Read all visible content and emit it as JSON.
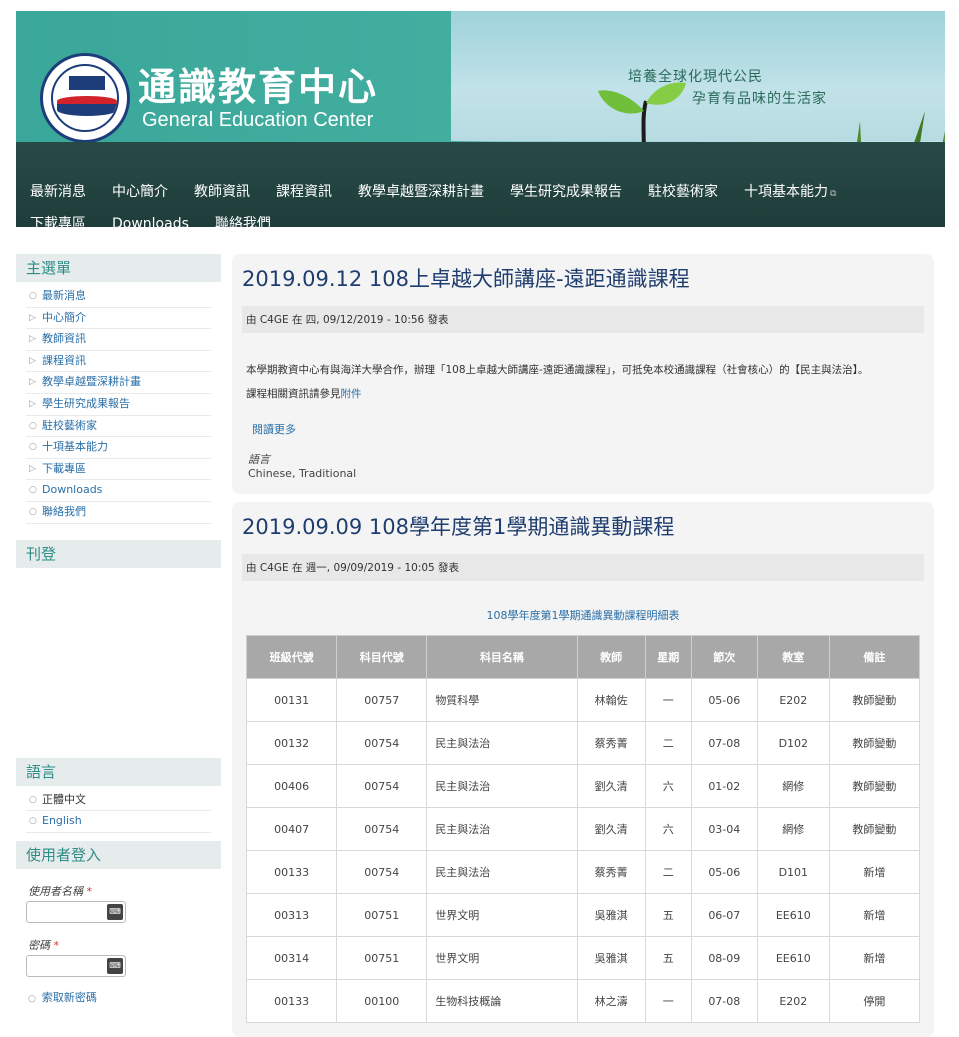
{
  "header": {
    "title": "通識教育中心",
    "subtitle": "General Education Center",
    "slogan_line1": "培養全球化現代公民",
    "slogan_line2": "孕育有品味的生活家",
    "nav": [
      "最新消息",
      "中心簡介",
      "教師資訊",
      "課程資訊",
      "教學卓越暨深耕計畫",
      "學生研究成果報告",
      "駐校藝術家",
      "十項基本能力",
      "下載專區",
      "Downloads",
      "聯絡我們"
    ]
  },
  "sidebar": {
    "main_menu_title": "主選單",
    "main_menu": [
      {
        "label": "最新消息",
        "bullet": "○"
      },
      {
        "label": "中心簡介",
        "bullet": "▷"
      },
      {
        "label": "教師資訊",
        "bullet": "▷"
      },
      {
        "label": "課程資訊",
        "bullet": "▷"
      },
      {
        "label": "教學卓越暨深耕計畫",
        "bullet": "▷"
      },
      {
        "label": "學生研究成果報告",
        "bullet": "▷"
      },
      {
        "label": "駐校藝術家",
        "bullet": "○"
      },
      {
        "label": "十項基本能力",
        "bullet": "○"
      },
      {
        "label": "下載專區",
        "bullet": "▷"
      },
      {
        "label": "Downloads",
        "bullet": "○"
      },
      {
        "label": "聯絡我們",
        "bullet": "○"
      }
    ],
    "publish_title": "刊登",
    "lang_title": "語言",
    "languages": [
      "正體中文",
      "English"
    ],
    "login_title": "使用者登入",
    "username_label": "使用者名稱",
    "password_label": "密碼",
    "required_mark": "*",
    "forgot_password": "索取新密碼"
  },
  "posts": [
    {
      "title": "2019.09.12 108上卓越大師講座-遠距通識課程",
      "submitted": "由 C4GE 在 四, 09/12/2019 - 10:56 發表",
      "body_p1": "本學期教資中心有與海洋大學合作，辦理「108上卓越大師講座-遠距通識課程」，可抵免本校通識課程（社會核心）的【民主與法治】。",
      "body_p2_prefix": "課程相關資訊請參見",
      "body_p2_link": "附件",
      "read_more": "閱讀更多",
      "lang_label": "語言",
      "lang_value": "Chinese, Traditional"
    },
    {
      "title": "2019.09.09 108學年度第1學期通識異動課程",
      "submitted": "由 C4GE 在 週一, 09/09/2019 - 10:05 發表",
      "table_caption": "108學年度第1學期通識異動課程明細表"
    }
  ],
  "course_table": {
    "headers": [
      "班級代號",
      "科目代號",
      "科目名稱",
      "教師",
      "星期",
      "節次",
      "教室",
      "備註"
    ],
    "rows": [
      [
        "00131",
        "00757",
        "物質科學",
        "林翰佐",
        "一",
        "05-06",
        "E202",
        "教師變動"
      ],
      [
        "00132",
        "00754",
        "民主與法治",
        "蔡秀菁",
        "二",
        "07-08",
        "D102",
        "教師變動"
      ],
      [
        "00406",
        "00754",
        "民主與法治",
        "劉久清",
        "六",
        "01-02",
        "網修",
        "教師變動"
      ],
      [
        "00407",
        "00754",
        "民主與法治",
        "劉久清",
        "六",
        "03-04",
        "網修",
        "教師變動"
      ],
      [
        "00133",
        "00754",
        "民主與法治",
        "蔡秀菁",
        "二",
        "05-06",
        "D101",
        "新增"
      ],
      [
        "00313",
        "00751",
        "世界文明",
        "吳雅淇",
        "五",
        "06-07",
        "EE610",
        "新增"
      ],
      [
        "00314",
        "00751",
        "世界文明",
        "吳雅淇",
        "五",
        "08-09",
        "EE610",
        "新增"
      ],
      [
        "00133",
        "00100",
        "生物科技概論",
        "林之濤",
        "一",
        "07-08",
        "E202",
        "停開"
      ]
    ]
  },
  "colors": {
    "header_teal": "#3aa79a",
    "nav_dark": "#1f3d3a",
    "link_blue": "#2a6fa8",
    "title_navy": "#1f3d6e",
    "sidebar_title": "#2f8d88"
  }
}
